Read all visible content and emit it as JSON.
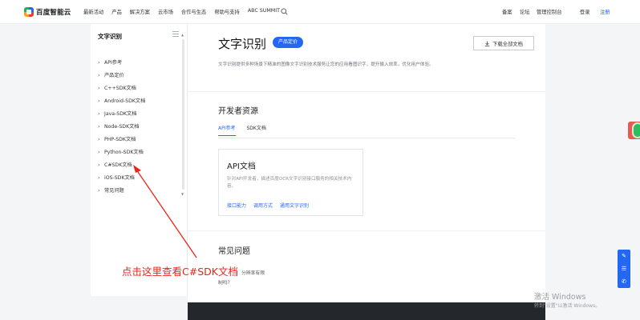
{
  "brand": {
    "name": "百度智能云"
  },
  "topnav": {
    "links": [
      "最新活动",
      "产品",
      "解决方案",
      "云市场",
      "合作与生态",
      "帮助与支持",
      "ABC SUMMIT"
    ],
    "right_links": [
      "备案",
      "论坛",
      "管理控制台"
    ],
    "login": "登录",
    "register": "注册"
  },
  "sidebar": {
    "title": "文字识别",
    "items": [
      {
        "label": "API参考"
      },
      {
        "label": "产品定价"
      },
      {
        "label": "C++SDK文档"
      },
      {
        "label": "Android-SDK文档"
      },
      {
        "label": "Java-SDK文档"
      },
      {
        "label": "Node-SDK文档"
      },
      {
        "label": "PHP-SDK文档"
      },
      {
        "label": "Python-SDK文档"
      },
      {
        "label": "C#SDK文档"
      },
      {
        "label": "iOS-SDK文档"
      },
      {
        "label": "常见问题"
      }
    ]
  },
  "hero": {
    "title": "文字识别",
    "tag": "产品定价",
    "download": "下载全部文档",
    "description": "文字识别提供多种场景下精准的图像文字识别技术服务让您的应用看图识字，提升输入效率，优化用户体验。"
  },
  "resources": {
    "title": "开发者资源",
    "tabs": [
      "API参考",
      "SDK文档"
    ],
    "active_tab": "API参考",
    "card": {
      "title": "API文档",
      "description": "针对API开发者，描述百度OCR文字识别接口服务的相关技术内容。",
      "links": [
        "接口能力",
        "调用方式",
        "通用文字识别"
      ]
    }
  },
  "faq": {
    "title": "常见问题",
    "question_line1": "分辨率有限",
    "question_line2": "制吗?"
  },
  "annotation": {
    "text": "点击这里查看C#SDK文档",
    "color": "#e8261b"
  },
  "watermark": {
    "line1": "激活 Windows",
    "line2": "转到\"设置\"以激活 Windows。"
  },
  "colors": {
    "accent": "#2468f2",
    "footer": "#24272c"
  }
}
